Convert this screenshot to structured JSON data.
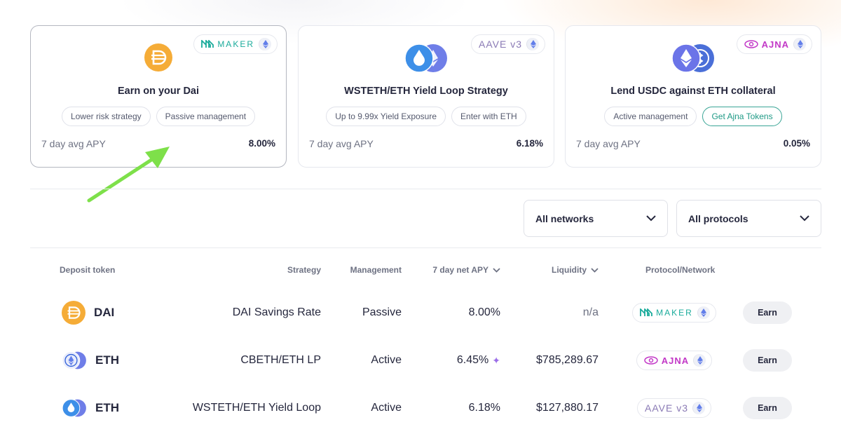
{
  "cards": [
    {
      "title": "Earn on your Dai",
      "protocol": "MAKER",
      "icon": "dai-icon",
      "tags": [
        "Lower risk strategy",
        "Passive management"
      ],
      "apy_label": "7 day avg APY",
      "apy_value": "8.00%",
      "selected": true
    },
    {
      "title": "WSTETH/ETH Yield Loop Strategy",
      "protocol": "AAVE v3",
      "icon": "wsteth-eth-icon",
      "tags": [
        "Up to 9.99x Yield Exposure",
        "Enter with ETH"
      ],
      "apy_label": "7 day avg APY",
      "apy_value": "6.18%"
    },
    {
      "title": "Lend USDC against ETH collateral",
      "protocol": "AJNA",
      "icon": "eth-usdc-icon",
      "tags": [
        "Active management",
        "Get Ajna Tokens"
      ],
      "apy_label": "7 day avg APY",
      "apy_value": "0.05%"
    }
  ],
  "filters": {
    "networks": "All networks",
    "protocols": "All protocols"
  },
  "table": {
    "headers": {
      "deposit_token": "Deposit token",
      "strategy": "Strategy",
      "management": "Management",
      "apy": "7 day net APY",
      "liquidity": "Liquidity",
      "protocol": "Protocol/Network"
    },
    "rows": [
      {
        "token": "DAI",
        "strategy": "DAI Savings Rate",
        "management": "Passive",
        "apy": "8.00%",
        "liquidity": "n/a",
        "protocol": "MAKER",
        "action": "Earn"
      },
      {
        "token": "ETH",
        "strategy": "CBETH/ETH LP",
        "management": "Active",
        "apy": "6.45%",
        "liquidity": "$785,289.67",
        "protocol": "AJNA",
        "action": "Earn"
      },
      {
        "token": "ETH",
        "strategy": "WSTETH/ETH Yield Loop",
        "management": "Active",
        "apy": "6.18%",
        "liquidity": "$127,880.17",
        "protocol": "AAVE v3",
        "action": "Earn"
      }
    ]
  },
  "colors": {
    "dai": "#f5ac37",
    "eth": "#627eea",
    "maker": "#1aab9b",
    "ajna": "#c238c7",
    "aave": "#8a7ab5",
    "arrow": "#7ee04a"
  }
}
